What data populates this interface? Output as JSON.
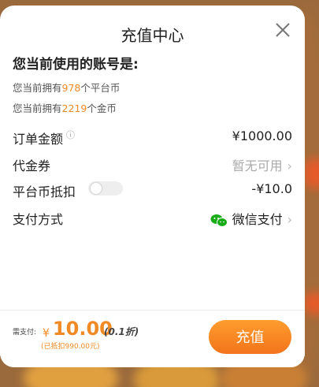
{
  "modal": {
    "title": "充值中心",
    "account_label": "您当前使用的账号是:",
    "balances": [
      {
        "prefix": "您当前拥有",
        "num": "978",
        "suffix": "个平台币"
      },
      {
        "prefix": "您当前拥有",
        "num": "2219",
        "suffix": "个金币"
      }
    ],
    "rows": {
      "order_amount": {
        "label": "订单金额",
        "value": "¥1000.00"
      },
      "voucher": {
        "label": "代金券",
        "value": "暂无可用"
      },
      "platform_coin": {
        "label": "平台币抵扣",
        "value": "-¥10.0",
        "toggle_on": false
      },
      "payment": {
        "label": "支付方式",
        "value": "微信支付",
        "icon": "wechat-icon"
      }
    },
    "footer": {
      "pay_label": "需支付:",
      "currency": "¥",
      "amount": "10.00",
      "discount": "(0.1折)",
      "deducted": "(已抵扣990.00元)",
      "button": "充值"
    }
  },
  "colors": {
    "accent": "#f08a24",
    "wechat": "#1aad19"
  }
}
